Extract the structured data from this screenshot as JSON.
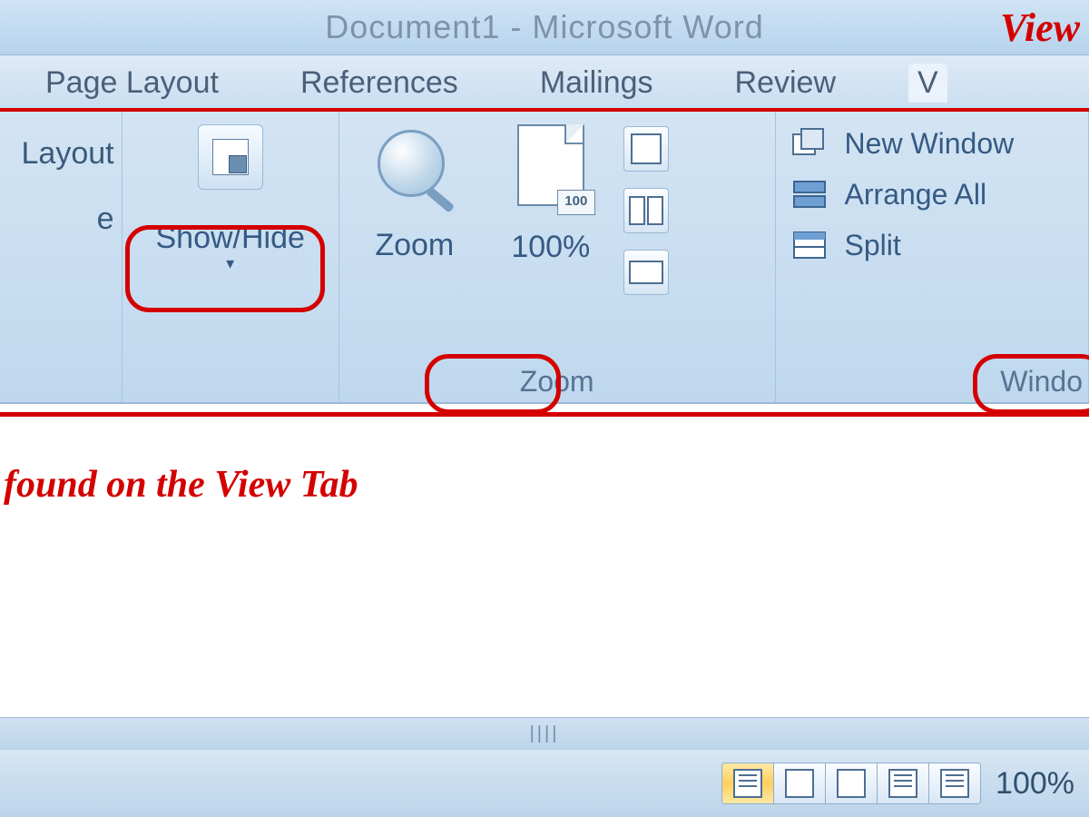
{
  "title": "Document1 - Microsoft Word",
  "annotations": {
    "view": "View",
    "caption": "found on the View Tab"
  },
  "tabs": {
    "items": [
      {
        "label": "Page Layout"
      },
      {
        "label": "References"
      },
      {
        "label": "Mailings"
      },
      {
        "label": "Review"
      },
      {
        "label": "V"
      }
    ]
  },
  "ribbon": {
    "left_fragment_top": "Layout",
    "left_fragment_bottom": "e",
    "showhide": {
      "label": "Show/Hide"
    },
    "zoom_group": {
      "label": "Zoom",
      "zoom_btn": "Zoom",
      "hundred_btn": "100%",
      "stamp": "100"
    },
    "window_group": {
      "label": "Windo",
      "items": [
        "New Window",
        "Arrange All",
        "Split"
      ]
    }
  },
  "statusbar": {
    "zoom": "100%"
  }
}
